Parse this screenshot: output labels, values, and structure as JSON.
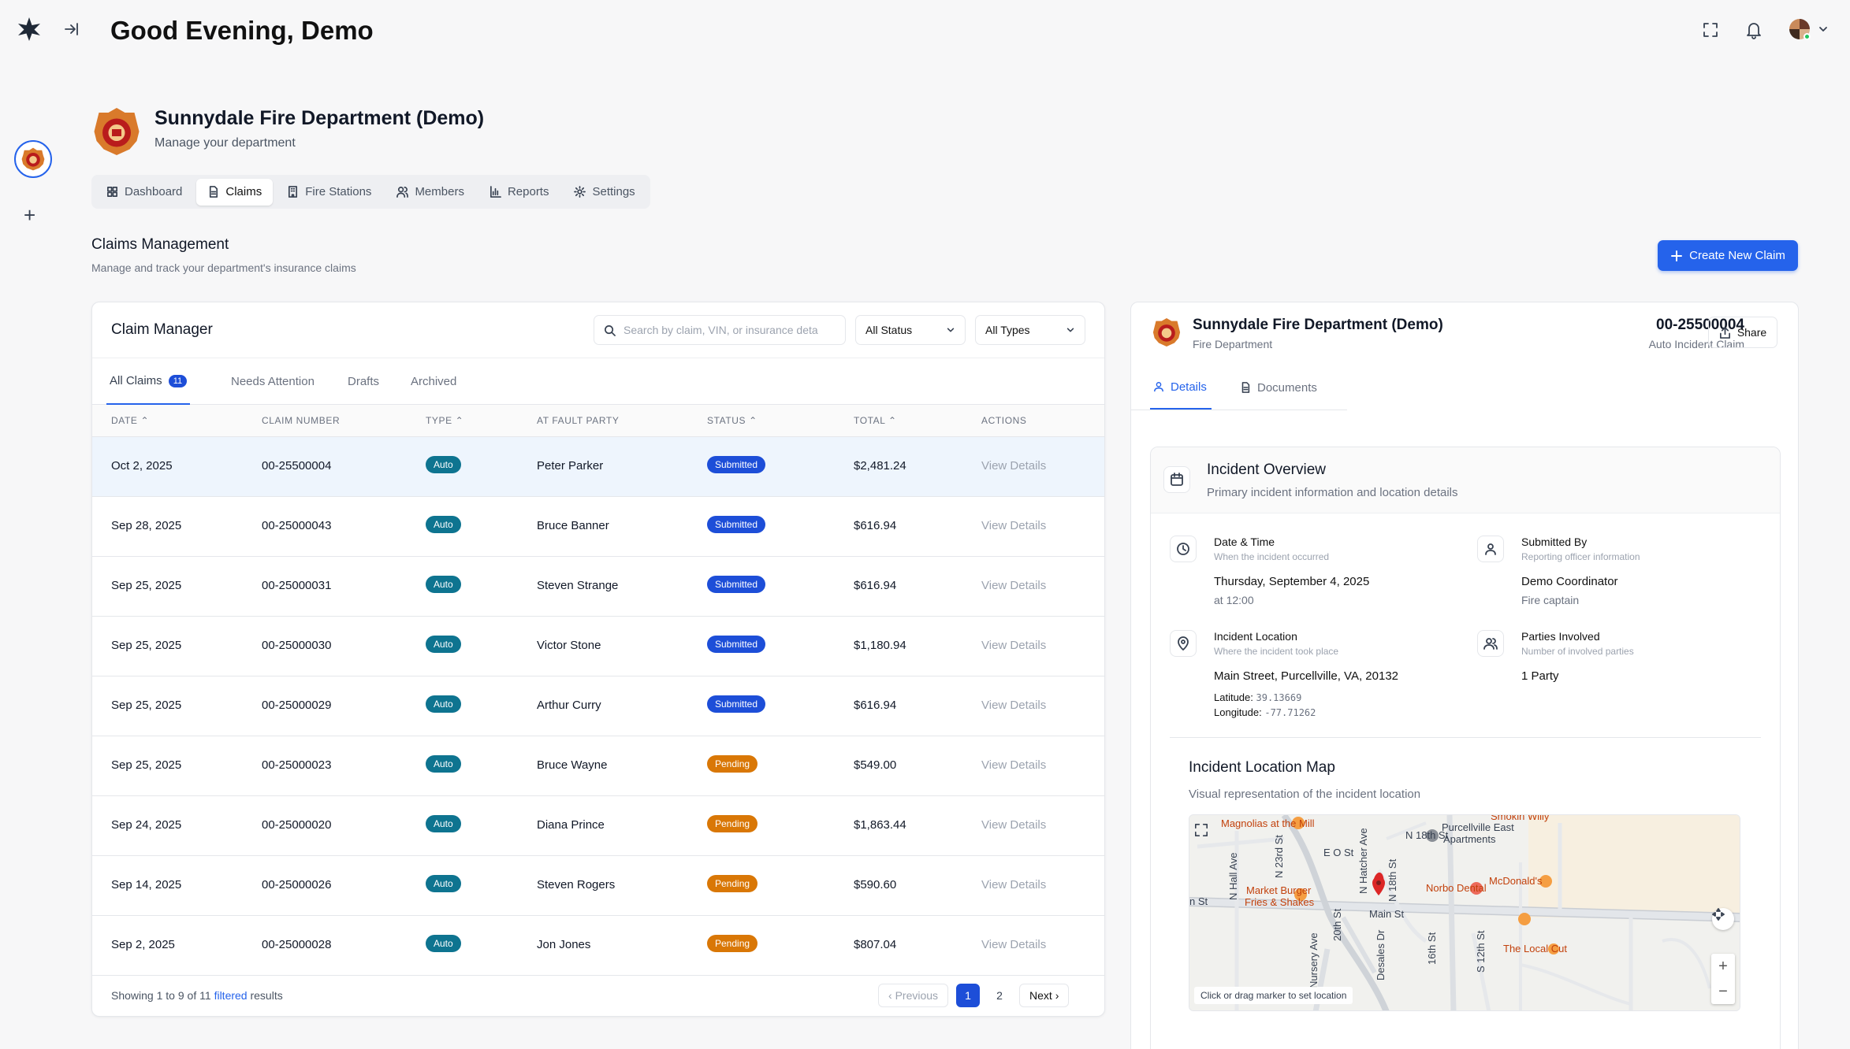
{
  "header": {
    "greeting": "Good Evening, Demo"
  },
  "department": {
    "name": "Sunnydale Fire Department (Demo)",
    "subtitle": "Manage your department"
  },
  "tabs": [
    {
      "label": "Dashboard",
      "icon": "grid-icon"
    },
    {
      "label": "Claims",
      "icon": "document-icon"
    },
    {
      "label": "Fire Stations",
      "icon": "building-icon"
    },
    {
      "label": "Members",
      "icon": "users-icon"
    },
    {
      "label": "Reports",
      "icon": "bar-chart-icon"
    },
    {
      "label": "Settings",
      "icon": "gear-icon"
    }
  ],
  "claims_section": {
    "title": "Claims Management",
    "subtitle": "Manage and track your department's insurance claims",
    "create_button": "Create New Claim"
  },
  "claim_manager": {
    "title": "Claim Manager",
    "search_placeholder": "Search by claim, VIN, or insurance deta",
    "status_filter": "All Status",
    "type_filter": "All Types",
    "subtabs": [
      {
        "label": "All Claims",
        "count": "11"
      },
      {
        "label": "Needs Attention"
      },
      {
        "label": "Drafts"
      },
      {
        "label": "Archived"
      }
    ],
    "columns": [
      "DATE ⌃",
      "CLAIM NUMBER",
      "TYPE ⌃",
      "AT FAULT PARTY",
      "STATUS ⌃",
      "TOTAL ⌃",
      "ACTIONS"
    ],
    "rows": [
      {
        "date": "Oct 2, 2025",
        "number": "00-25500004",
        "type": "Auto",
        "party": "Peter Parker",
        "status": "Submitted",
        "total": "$2,481.24",
        "action": "View Details"
      },
      {
        "date": "Sep 28, 2025",
        "number": "00-25000043",
        "type": "Auto",
        "party": "Bruce Banner",
        "status": "Submitted",
        "total": "$616.94",
        "action": "View Details"
      },
      {
        "date": "Sep 25, 2025",
        "number": "00-25000031",
        "type": "Auto",
        "party": "Steven Strange",
        "status": "Submitted",
        "total": "$616.94",
        "action": "View Details"
      },
      {
        "date": "Sep 25, 2025",
        "number": "00-25000030",
        "type": "Auto",
        "party": "Victor Stone",
        "status": "Submitted",
        "total": "$1,180.94",
        "action": "View Details"
      },
      {
        "date": "Sep 25, 2025",
        "number": "00-25000029",
        "type": "Auto",
        "party": "Arthur Curry",
        "status": "Submitted",
        "total": "$616.94",
        "action": "View Details"
      },
      {
        "date": "Sep 25, 2025",
        "number": "00-25000023",
        "type": "Auto",
        "party": "Bruce Wayne",
        "status": "Pending",
        "total": "$549.00",
        "action": "View Details"
      },
      {
        "date": "Sep 24, 2025",
        "number": "00-25000020",
        "type": "Auto",
        "party": "Diana Prince",
        "status": "Pending",
        "total": "$1,863.44",
        "action": "View Details"
      },
      {
        "date": "Sep 14, 2025",
        "number": "00-25000026",
        "type": "Auto",
        "party": "Steven Rogers",
        "status": "Pending",
        "total": "$590.60",
        "action": "View Details"
      },
      {
        "date": "Sep 2, 2025",
        "number": "00-25000028",
        "type": "Auto",
        "party": "Jon Jones",
        "status": "Pending",
        "total": "$807.04",
        "action": "View Details"
      }
    ],
    "footer": {
      "prefix": "Showing",
      "from": "1",
      "to_word": "to",
      "to": "9",
      "of_word": "of",
      "total": "11",
      "filtered": "filtered",
      "suffix": "results"
    },
    "pager": {
      "previous": "Previous",
      "pages": [
        "1",
        "2"
      ],
      "next": "Next"
    }
  },
  "details": {
    "dept_name": "Sunnydale Fire Department (Demo)",
    "dept_type": "Fire Department",
    "claim_number": "00-25500004",
    "claim_type": "Auto Incident Claim",
    "share": "Share",
    "tabs": [
      "Details",
      "Documents"
    ],
    "overview_title": "Incident Overview",
    "overview_sub": "Primary incident information and location details",
    "fields": {
      "datetime_label": "Date & Time",
      "datetime_sub": "When the incident occurred",
      "datetime_val": "Thursday, September 4, 2025",
      "datetime_val2": "at 12:00",
      "submitted_label": "Submitted By",
      "submitted_sub": "Reporting officer information",
      "submitted_val": "Demo Coordinator",
      "submitted_val2": "Fire captain",
      "location_label": "Incident Location",
      "location_sub": "Where the incident took place",
      "location_val": "Main Street, Purcellville, VA, 20132",
      "lat_label": "Latitude:",
      "lat_val": "39.13669",
      "lon_label": "Longitude:",
      "lon_val": "-77.71262",
      "parties_label": "Parties Involved",
      "parties_sub": "Number of involved parties",
      "parties_val": "1 Party"
    },
    "map_title": "Incident Location Map",
    "map_sub": "Visual representation of the incident location",
    "map_hint": "Click or drag marker to set location",
    "map_labels": {
      "magnolias": "Magnolias at the Mill",
      "purcellville_east_1": "Purcellville East",
      "purcellville_east_2": "Apartments",
      "smokin": "Smokin Willy",
      "market_burger_1": "Market Burger",
      "market_burger_2": "Fries & Shakes",
      "norbo": "Norbo Dental",
      "mcdonalds": "McDonald's",
      "main_st": "Main St",
      "n_st": "n St",
      "e_o_st": "E O St",
      "n_18th_st": "N 18th St",
      "n_hall_ave": "N Hall Ave",
      "n_23rd_st": "N 23rd St",
      "n_hatcher_ave": "N Hatcher Ave",
      "n_18th_st_v": "N 18th St",
      "s_20th_st": "20th St",
      "nursery_ave": "Nursery Ave",
      "desales_dr": "Desales Dr",
      "s_16th": "16th St",
      "s_12th": "S 12th St",
      "local_cut": "The Local Cut"
    }
  },
  "colors": {
    "primary": "#2563eb",
    "submitted": "#1d4ed8",
    "pending": "#d97706",
    "auto": "#0e7490"
  }
}
